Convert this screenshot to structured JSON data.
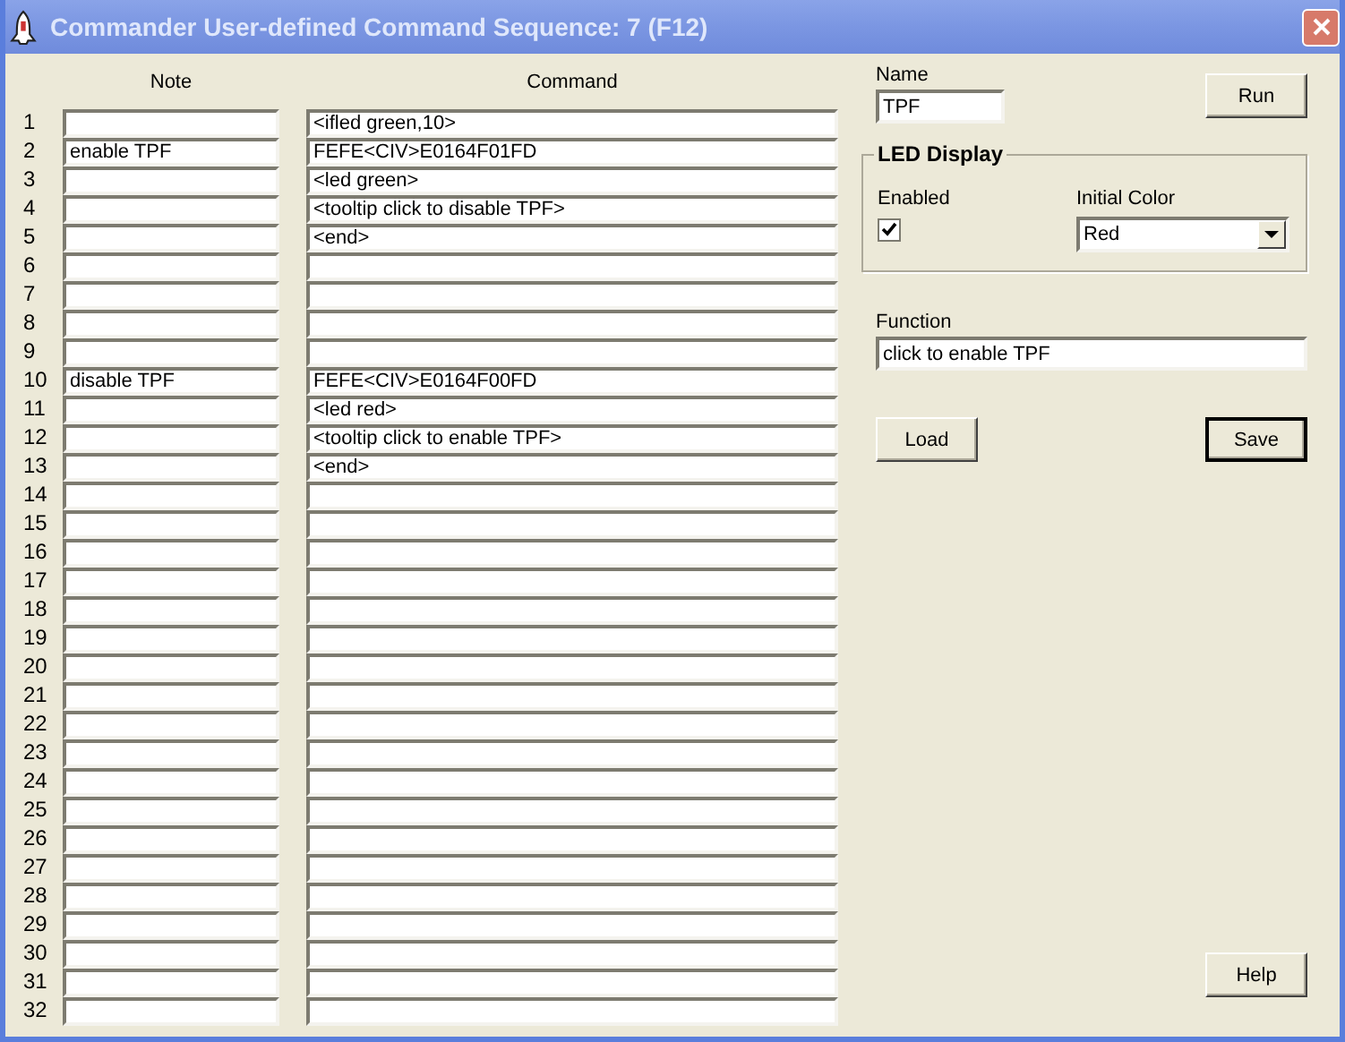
{
  "window": {
    "title": "Commander User-defined Command Sequence: 7 (F12)"
  },
  "columns": [
    "Note",
    "Command"
  ],
  "rows": [
    {
      "number": "1",
      "command": "<ifled green,10>"
    },
    {
      "number": "2",
      "note": "enable TPF",
      "command": "FEFE<CIV>E0164F01FD"
    },
    {
      "number": "3",
      "command": "<led green>"
    },
    {
      "number": "4",
      "command": "<tooltip click to disable TPF>"
    },
    {
      "number": "5",
      "command": "<end>"
    },
    {
      "number": "6"
    },
    {
      "number": "7"
    },
    {
      "number": "8"
    },
    {
      "number": "9"
    },
    {
      "number": "10",
      "note": "disable TPF",
      "command": "FEFE<CIV>E0164F00FD"
    },
    {
      "number": "11",
      "command": "<led red>"
    },
    {
      "number": "12",
      "command": "<tooltip click to enable TPF>"
    },
    {
      "number": "13",
      "command": "<end>"
    },
    {
      "number": "14"
    },
    {
      "number": "15"
    },
    {
      "number": "16"
    },
    {
      "number": "17"
    },
    {
      "number": "18"
    },
    {
      "number": "19"
    },
    {
      "number": "20"
    },
    {
      "number": "21"
    },
    {
      "number": "22"
    },
    {
      "number": "23"
    },
    {
      "number": "24"
    },
    {
      "number": "25"
    },
    {
      "number": "26"
    },
    {
      "number": "27"
    },
    {
      "number": "28"
    },
    {
      "number": "29"
    },
    {
      "number": "30"
    },
    {
      "number": "31"
    },
    {
      "number": "32"
    }
  ],
  "name": {
    "label": "Name",
    "value": "TPF"
  },
  "led_display": {
    "title": "LED Display",
    "enabled_label": "Enabled",
    "enabled": true,
    "color_label": "Initial Color",
    "color_value": "Red"
  },
  "function": {
    "label": "Function",
    "value": "click to enable TPF"
  },
  "buttons": {
    "run": {
      "label": "Run",
      "default": false
    },
    "load": {
      "label": "Load",
      "default": false
    },
    "save": {
      "label": "Save",
      "default": true
    },
    "help": {
      "label": "Help",
      "default": false
    }
  }
}
